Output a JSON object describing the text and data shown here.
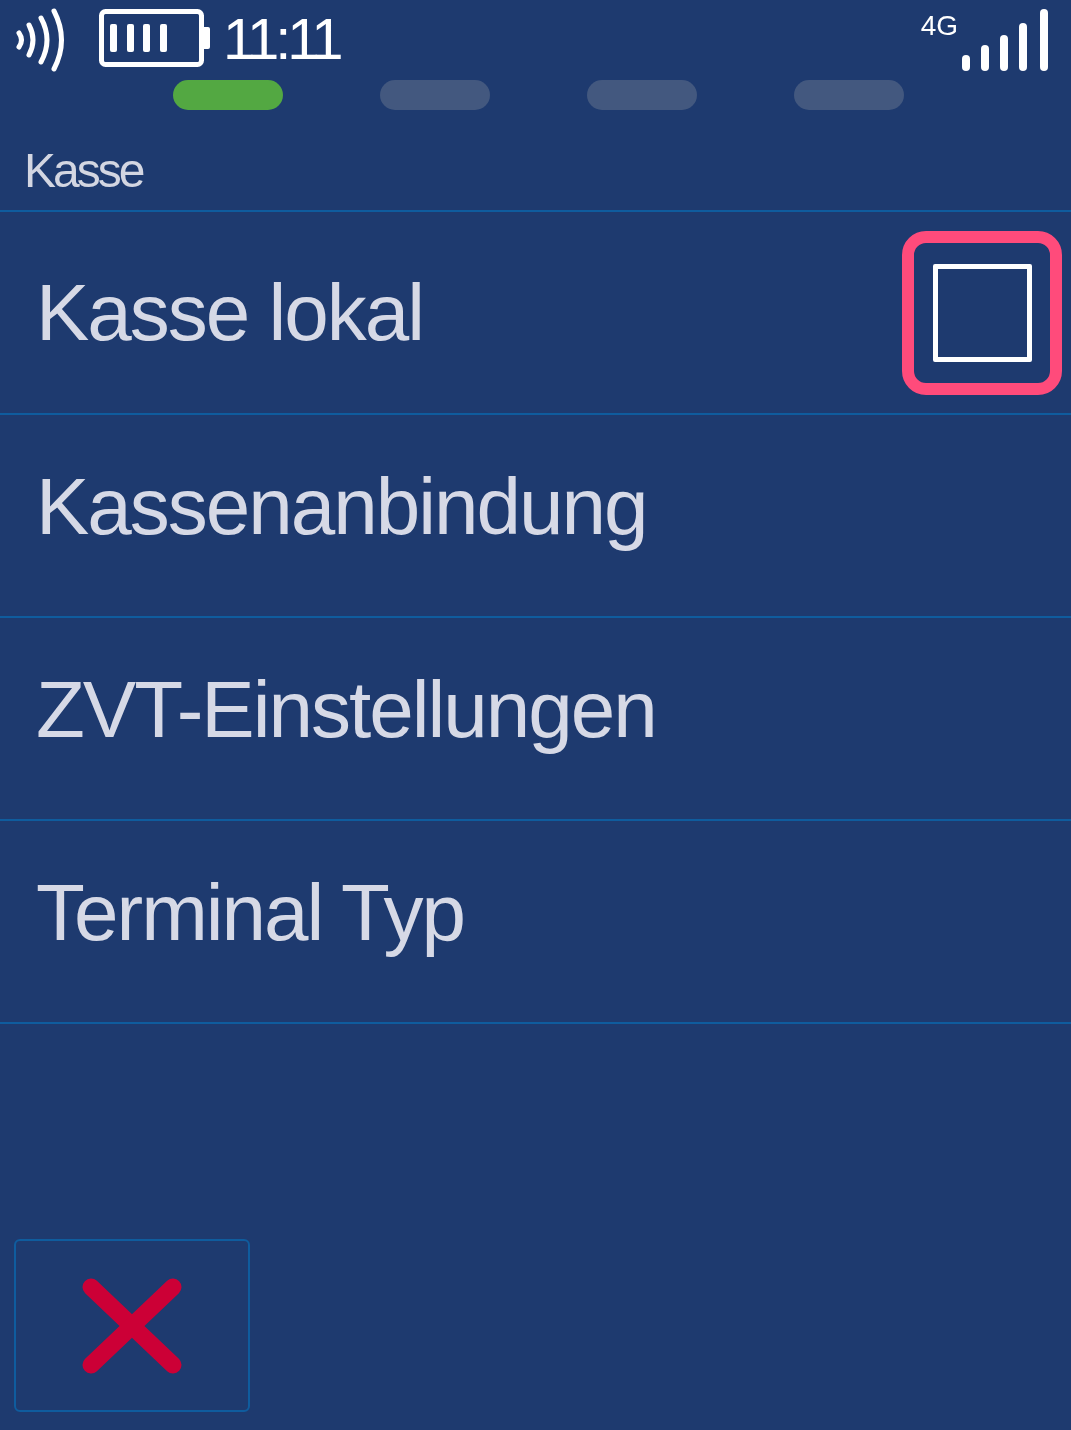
{
  "status_bar": {
    "time": "11:11",
    "network": "4G"
  },
  "steps": [
    {
      "active": true
    },
    {
      "active": false
    },
    {
      "active": false
    },
    {
      "active": false
    }
  ],
  "header": {
    "title": "Kasse"
  },
  "rows": [
    {
      "kind": "checkbox",
      "label": "Kasse lokal",
      "checked": false,
      "focused": true
    },
    {
      "kind": "link",
      "label": "Kassenanbindung",
      "focused": false
    },
    {
      "kind": "link",
      "label": "ZVT-Einstellungen",
      "focused": false
    },
    {
      "kind": "link",
      "label": "Terminal Typ",
      "focused": false
    }
  ]
}
